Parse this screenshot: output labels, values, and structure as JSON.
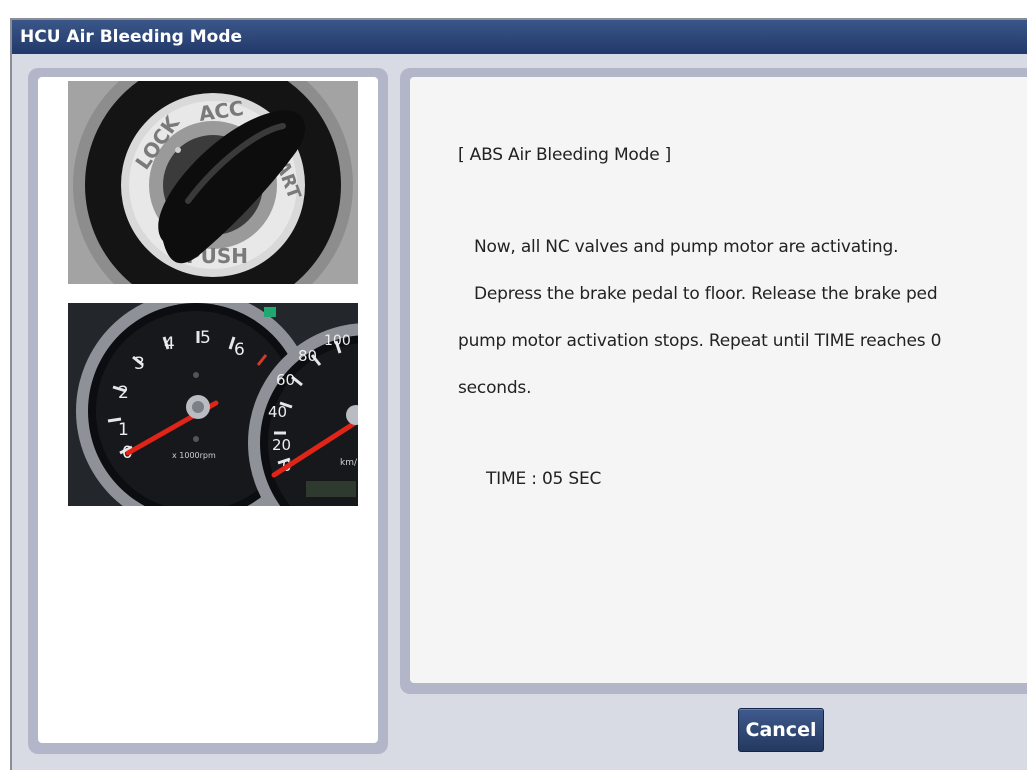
{
  "window": {
    "title": "HCU Air Bleeding Mode"
  },
  "ignition_image": {
    "lock": "LOCK",
    "acc": "ACC",
    "start": "START",
    "push": "PUSH"
  },
  "cluster_image": {
    "rpm_ticks": [
      "0",
      "1",
      "2",
      "3",
      "4",
      "5",
      "6"
    ],
    "rpm_unit": "x 1000rpm",
    "speed_ticks": [
      "0",
      "20",
      "40",
      "60",
      "80",
      "100"
    ],
    "speed_unit": "km/"
  },
  "message": {
    "heading": "[ ABS Air Bleeding Mode ]",
    "line1": "Now, all NC valves and pump motor are activating.",
    "line2": "Depress the brake pedal to floor. Release the brake ped",
    "line3": "pump motor activation stops. Repeat until TIME reaches 0",
    "line4": "seconds.",
    "time_label": "TIME : 05 SEC"
  },
  "buttons": {
    "cancel": "Cancel"
  }
}
